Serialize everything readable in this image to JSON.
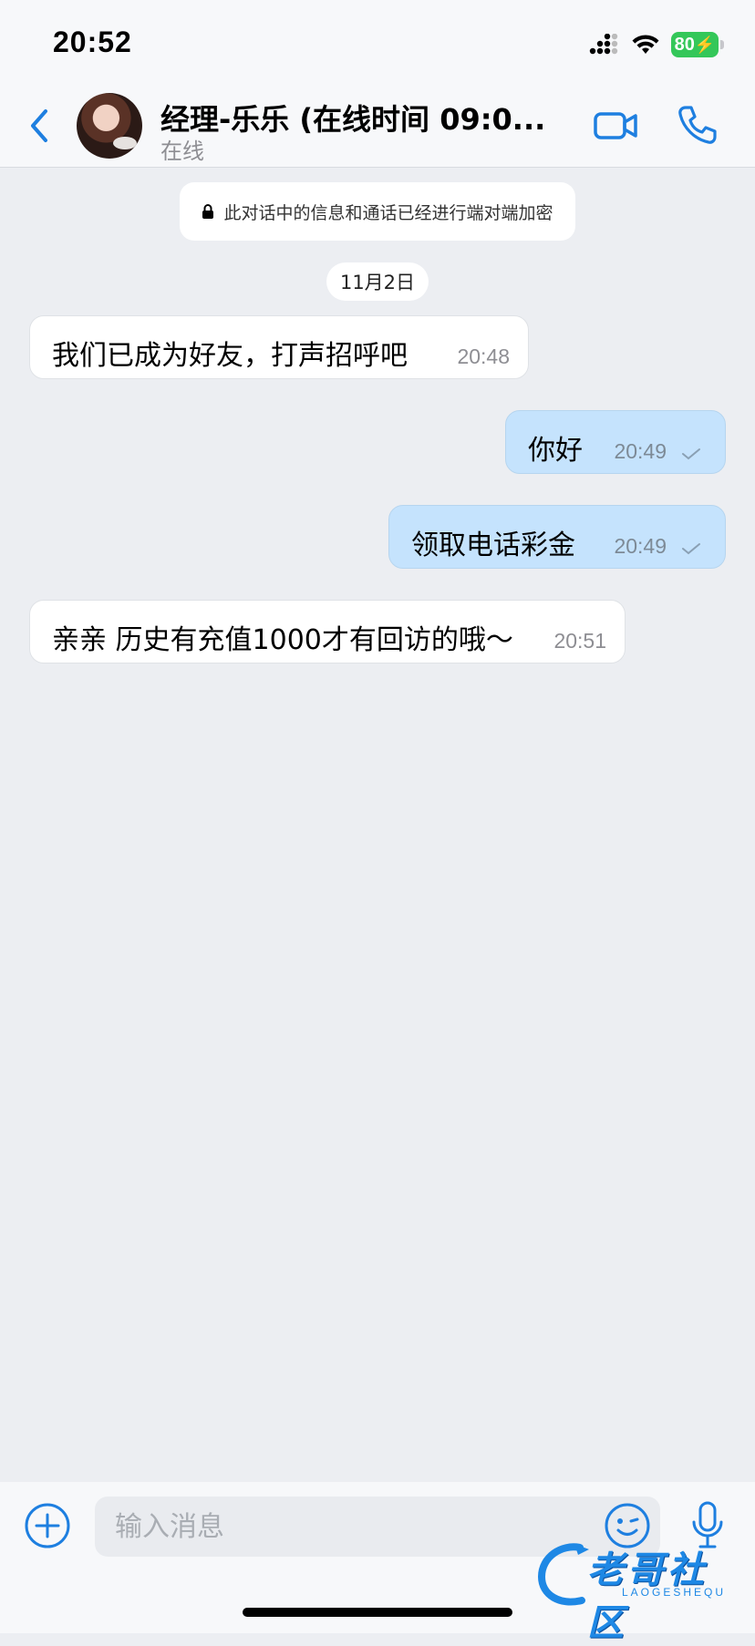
{
  "status_bar": {
    "time": "20:52",
    "battery": "80",
    "icons": [
      "cellular-signal-icon",
      "wifi-icon",
      "battery-charging-icon"
    ]
  },
  "header": {
    "contact_name": "经理-乐乐 (在线时间 09:0...",
    "contact_status": "在线",
    "icons": [
      "back-chevron-icon",
      "video-camera-icon",
      "phone-icon"
    ]
  },
  "chat": {
    "encryption_notice": "此对话中的信息和通话已经进行端对端加密",
    "date": "11月2日",
    "messages": [
      {
        "direction": "incoming",
        "text": "我们已成为好友，打声招呼吧",
        "time": "20:48"
      },
      {
        "direction": "outgoing",
        "text": "你好",
        "time": "20:49",
        "status": "sent"
      },
      {
        "direction": "outgoing",
        "text": "领取电话彩金",
        "time": "20:49",
        "status": "sent"
      },
      {
        "direction": "incoming",
        "text": "亲亲 历史有充值1000才有回访的哦～",
        "time": "20:51"
      }
    ]
  },
  "input_bar": {
    "placeholder": "输入消息",
    "icons": [
      "plus-circle-icon",
      "emoji-icon",
      "microphone-icon"
    ]
  },
  "watermark": {
    "text": "老哥社区",
    "subtext": "LAOGESHEQU"
  },
  "colors": {
    "accent": "#1e7fe0",
    "outgoing_bubble": "#c5e3fd",
    "incoming_bubble": "#ffffff",
    "chat_background": "#eceef2",
    "battery": "#34c759"
  }
}
